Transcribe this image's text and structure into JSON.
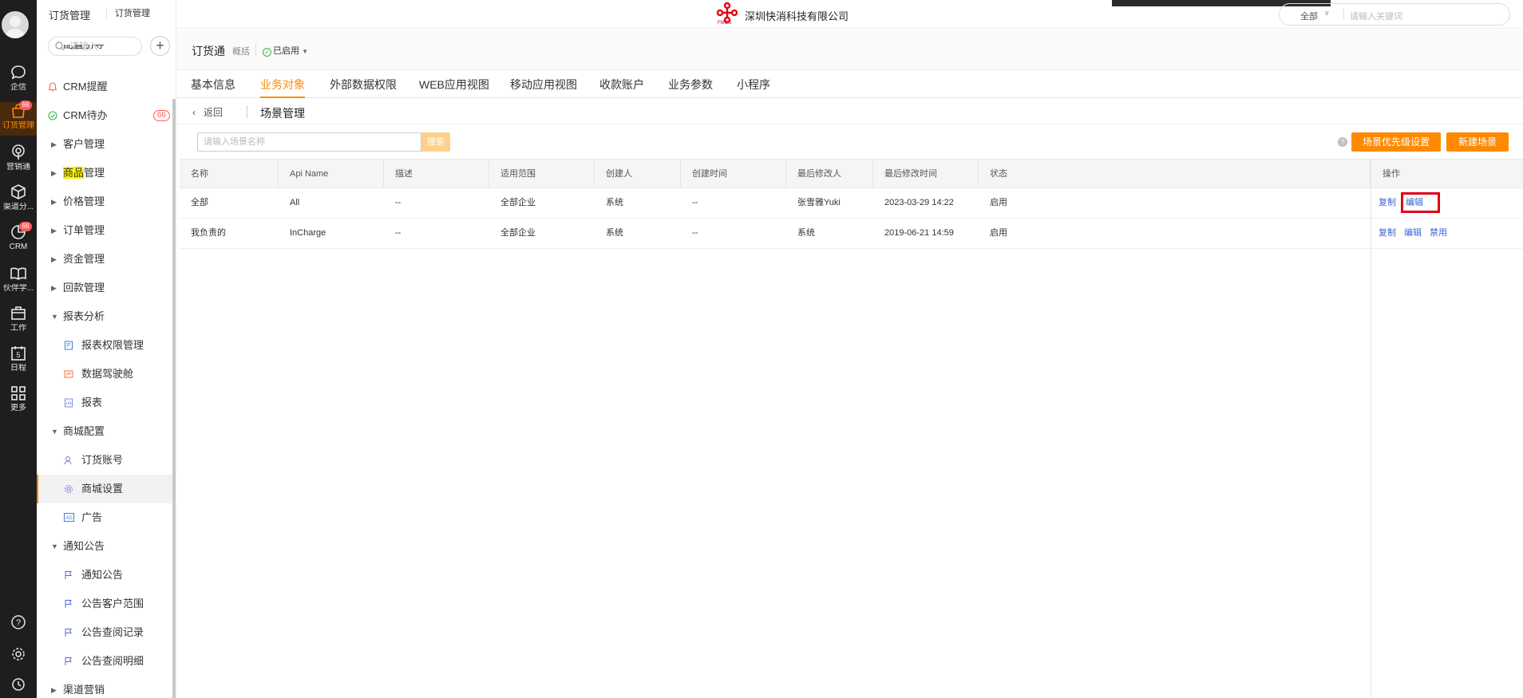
{
  "app": {
    "breadcrumb_main": "订货管理",
    "breadcrumb_sub": "订货管理",
    "company_name": "深圳快消科技有限公司",
    "logo_sub": "FMCG",
    "global_search": {
      "scope": "全部",
      "placeholder": "请输入关键词"
    }
  },
  "rail": {
    "items": [
      {
        "label": "企信",
        "icon": "chat-icon"
      },
      {
        "label": "订货管理",
        "icon": "bag-icon",
        "badge": "66",
        "active": true
      },
      {
        "label": "营销通",
        "icon": "broadcast-icon"
      },
      {
        "label": "渠道分...",
        "icon": "cube-icon"
      },
      {
        "label": "CRM",
        "icon": "pie-icon",
        "badge": "66"
      },
      {
        "label": "伙伴学...",
        "icon": "book-icon"
      },
      {
        "label": "工作",
        "icon": "briefcase-icon"
      },
      {
        "label": "日程",
        "icon": "calendar-icon",
        "day": "5"
      },
      {
        "label": "更多",
        "icon": "grid-icon"
      }
    ]
  },
  "menu": {
    "search_placeholder": "请输入",
    "partial_top": "配置引导",
    "items": [
      {
        "label": "CRM提醒",
        "icon": "bell-icon"
      },
      {
        "label": "CRM待办",
        "icon": "check-circle-icon",
        "badge": "66"
      },
      {
        "label": "客户管理",
        "caret": "right"
      },
      {
        "label": "商品",
        "label_rest": "管理",
        "caret": "right"
      },
      {
        "label": "价格管理",
        "caret": "right"
      },
      {
        "label": "订单管理",
        "caret": "right"
      },
      {
        "label": "资金管理",
        "caret": "right"
      },
      {
        "label": "回款管理",
        "caret": "right"
      },
      {
        "label": "报表分析",
        "caret": "down"
      },
      {
        "label": "报表权限管理",
        "sub": true,
        "icon": "report-perm-icon"
      },
      {
        "label": "数据驾驶舱",
        "sub": true,
        "icon": "dashboard-icon"
      },
      {
        "label": "报表",
        "sub": true,
        "icon": "report-icon"
      },
      {
        "label": "商城配置",
        "caret": "down"
      },
      {
        "label": "订货账号",
        "sub": true,
        "icon": "user-account-icon"
      },
      {
        "label": "商城设置",
        "sub": true,
        "icon": "settings-icon",
        "selected": true
      },
      {
        "label": "广告",
        "sub": true,
        "icon": "ad-icon"
      },
      {
        "label": "通知公告",
        "caret": "down"
      },
      {
        "label": "通知公告",
        "sub": true,
        "icon": "flag-icon"
      },
      {
        "label": "公告客户范围",
        "sub": true,
        "icon": "flag-icon"
      },
      {
        "label": "公告查阅记录",
        "sub": true,
        "icon": "flag-icon"
      },
      {
        "label": "公告查阅明细",
        "sub": true,
        "icon": "flag-icon"
      },
      {
        "label": "渠道营销",
        "caret": "right"
      }
    ]
  },
  "header": {
    "title": "订货通",
    "overview": "概括",
    "status": "已启用"
  },
  "tabs": [
    "基本信息",
    "业务对象",
    "外部数据权限",
    "WEB应用视图",
    "移动应用视图",
    "收款账户",
    "业务参数",
    "小程序"
  ],
  "active_tab": "业务对象",
  "subheader": {
    "back": "返回",
    "title": "场景管理"
  },
  "toolbar": {
    "search_placeholder": "请输入场景名称",
    "search_button": "搜索",
    "help": "?",
    "priority_button": "场景优先级设置",
    "new_button": "新建场景"
  },
  "table": {
    "columns": [
      "名称",
      "Api Name",
      "描述",
      "适用范围",
      "创建人",
      "创建时间",
      "最后修改人",
      "最后修改时间",
      "状态",
      "操作"
    ],
    "rows": [
      {
        "name": "全部",
        "api": "All",
        "desc": "--",
        "scope": "全部企业",
        "creator": "系统",
        "created": "--",
        "modifier": "张雪雅Yuki",
        "modified": "2023-03-29 14:22",
        "status": "启用",
        "ops": [
          "复制",
          "编辑"
        ]
      },
      {
        "name": "我负责的",
        "api": "InCharge",
        "desc": "--",
        "scope": "全部企业",
        "creator": "系统",
        "created": "--",
        "modifier": "系统",
        "modified": "2019-06-21 14:59",
        "status": "启用",
        "ops": [
          "复制",
          "编辑",
          "禁用"
        ]
      }
    ]
  },
  "colors": {
    "accent": "#ff8a00",
    "link": "#3a64d8",
    "highlight_box": "#e00012"
  }
}
